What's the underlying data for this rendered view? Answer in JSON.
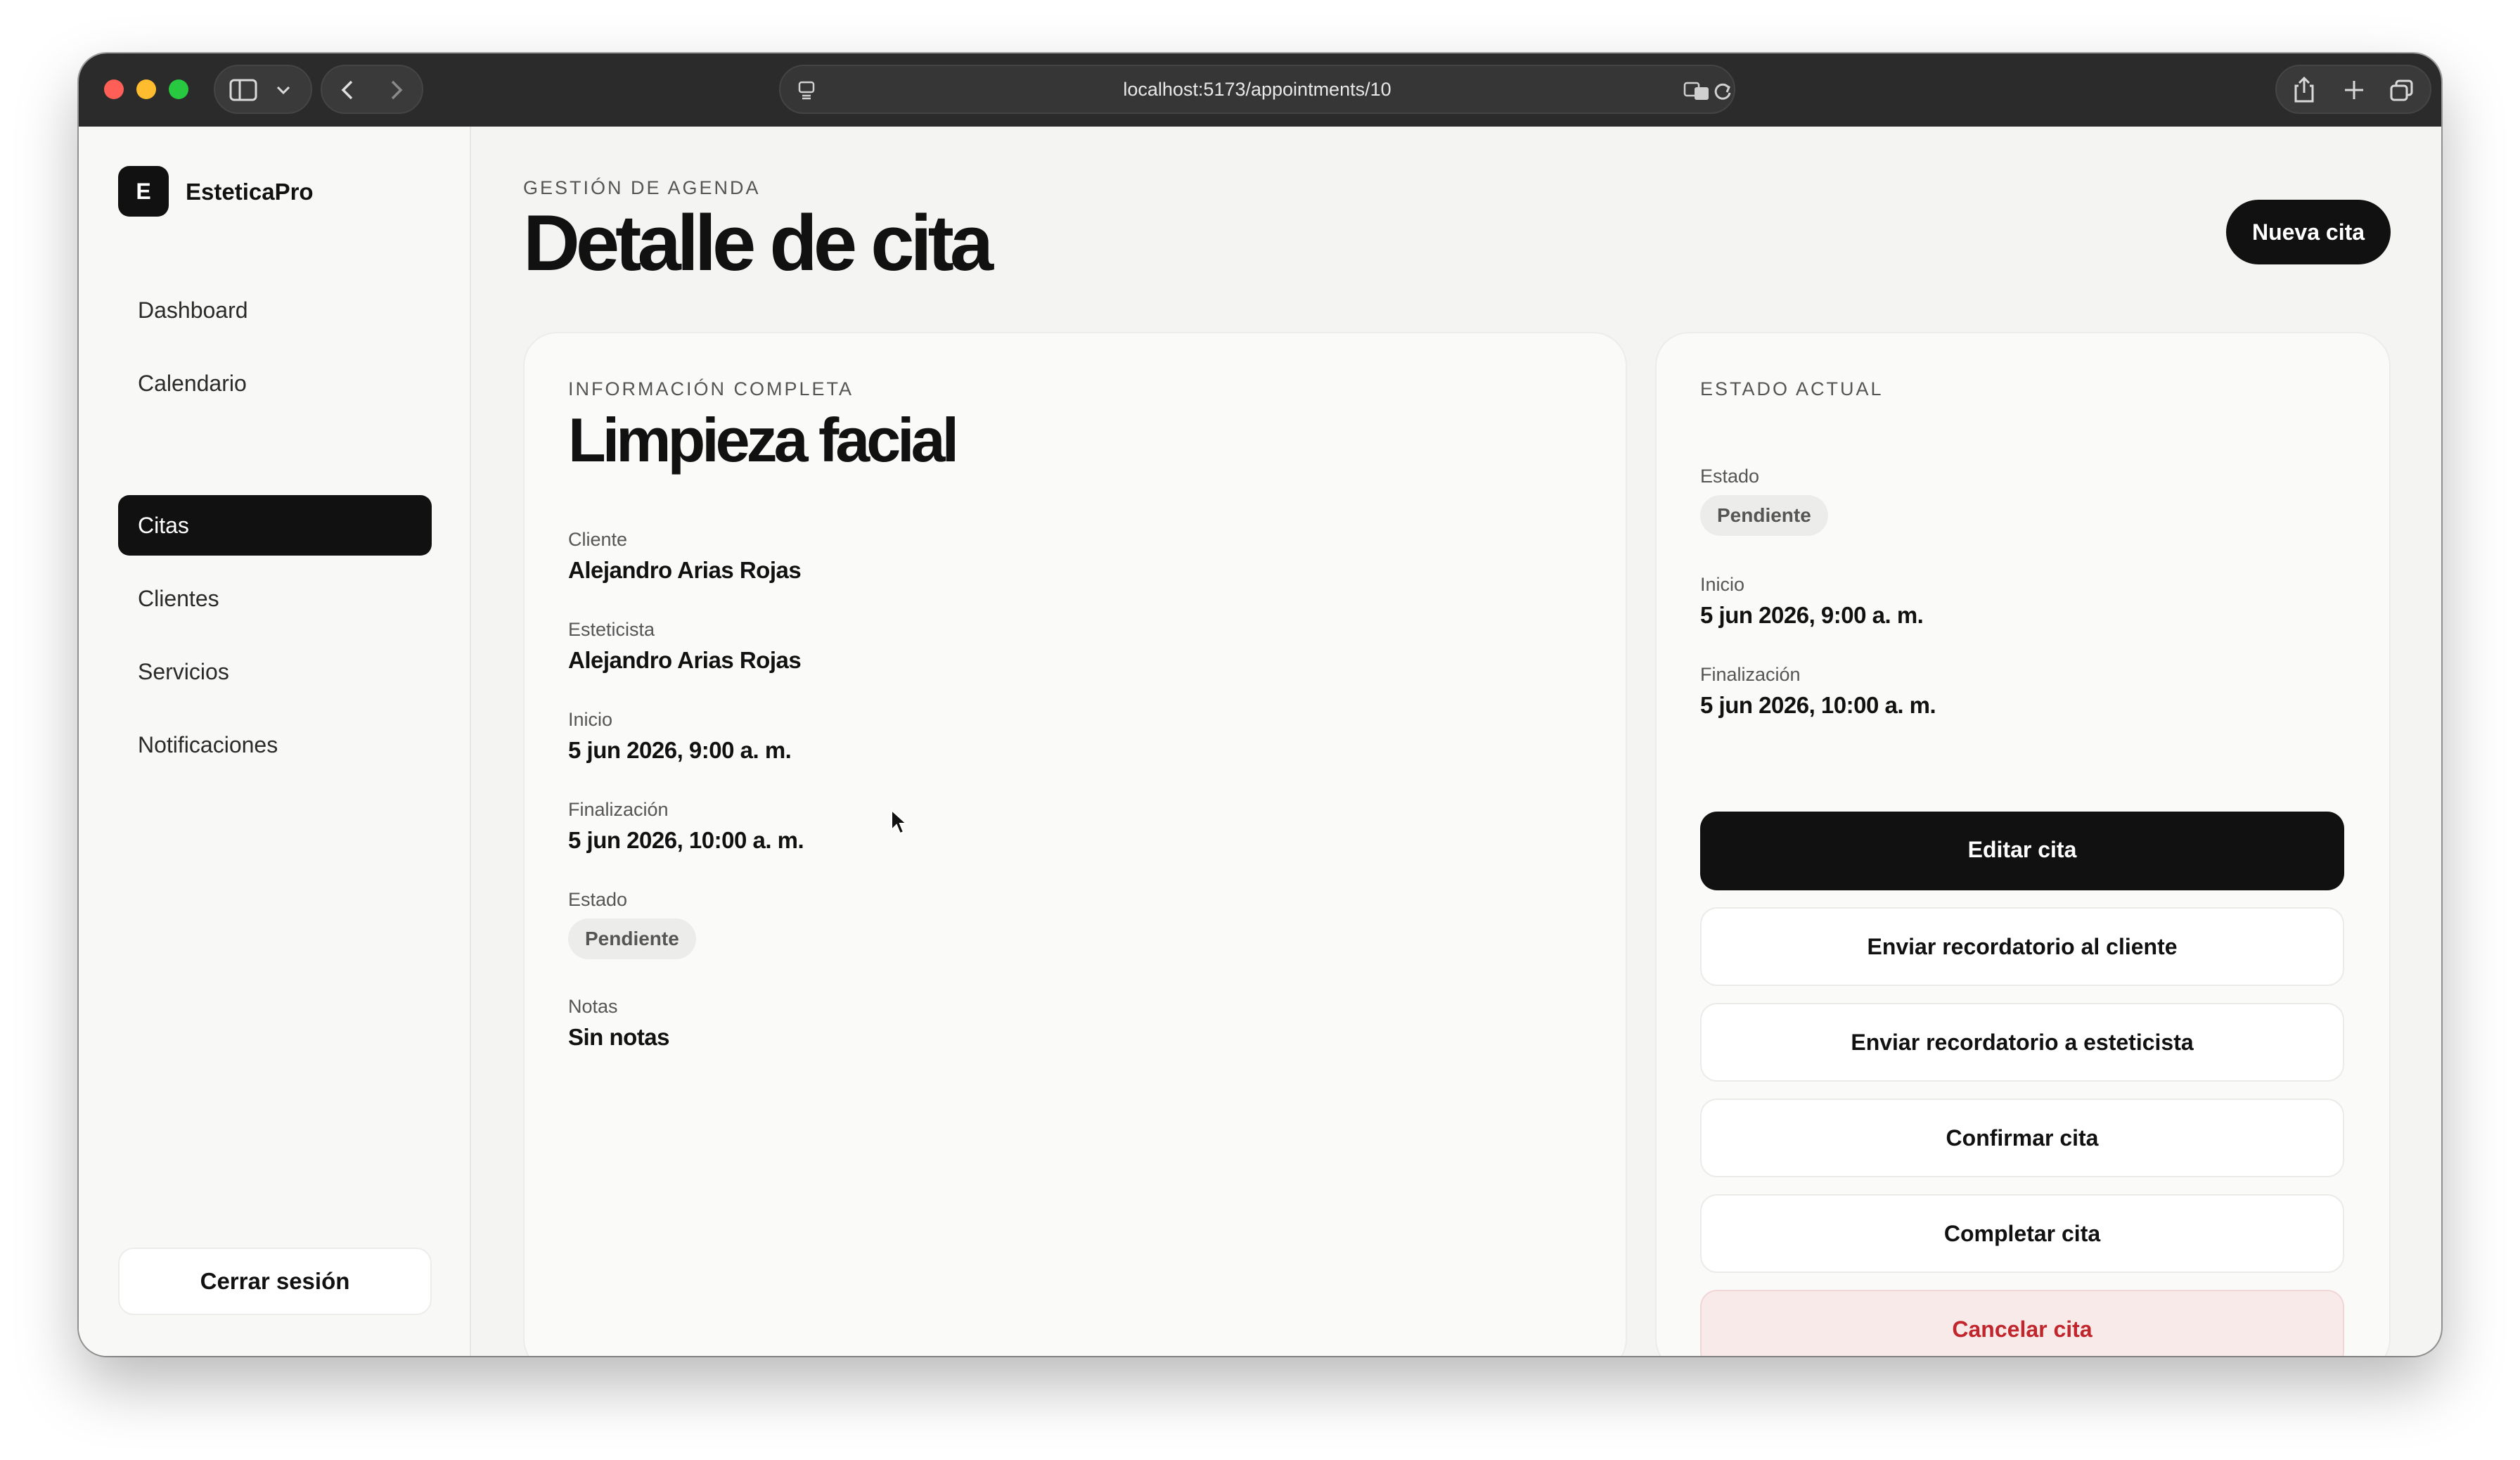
{
  "browser": {
    "url": "localhost:5173/appointments/10"
  },
  "sidebar": {
    "logo_letter": "E",
    "brand": "EsteticaPro",
    "items": [
      {
        "label": "Dashboard"
      },
      {
        "label": "Calendario"
      },
      {
        "label": "Citas",
        "active": true
      },
      {
        "label": "Clientes"
      },
      {
        "label": "Servicios"
      },
      {
        "label": "Notificaciones"
      }
    ],
    "logout_label": "Cerrar sesión"
  },
  "header": {
    "eyebrow": "GESTIÓN DE AGENDA",
    "title": "Detalle de cita",
    "new_button": "Nueva cita"
  },
  "details": {
    "eyebrow": "INFORMACIÓN COMPLETA",
    "title": "Limpieza facial",
    "client_label": "Cliente",
    "client_value": "Alejandro Arias Rojas",
    "esthetician_label": "Esteticista",
    "esthetician_value": "Alejandro Arias Rojas",
    "start_label": "Inicio",
    "start_value": "5 jun 2026, 9:00 a. m.",
    "end_label": "Finalización",
    "end_value": "5 jun 2026, 10:00 a. m.",
    "status_label": "Estado",
    "status_value": "Pendiente",
    "notes_label": "Notas",
    "notes_value": "Sin notas"
  },
  "status_panel": {
    "eyebrow": "ESTADO ACTUAL",
    "status_label": "Estado",
    "status_value": "Pendiente",
    "start_label": "Inicio",
    "start_value": "5 jun 2026, 9:00 a. m.",
    "end_label": "Finalización",
    "end_value": "5 jun 2026, 10:00 a. m.",
    "actions": {
      "edit": "Editar cita",
      "remind_client": "Enviar recordatorio al cliente",
      "remind_esthetician": "Enviar recordatorio a esteticista",
      "confirm": "Confirmar cita",
      "complete": "Completar cita",
      "cancel": "Cancelar cita"
    }
  },
  "colors": {
    "accent": "#111111",
    "danger": "#c0262c",
    "danger_bg": "#f9eaea",
    "badge_bg": "#ececea"
  }
}
